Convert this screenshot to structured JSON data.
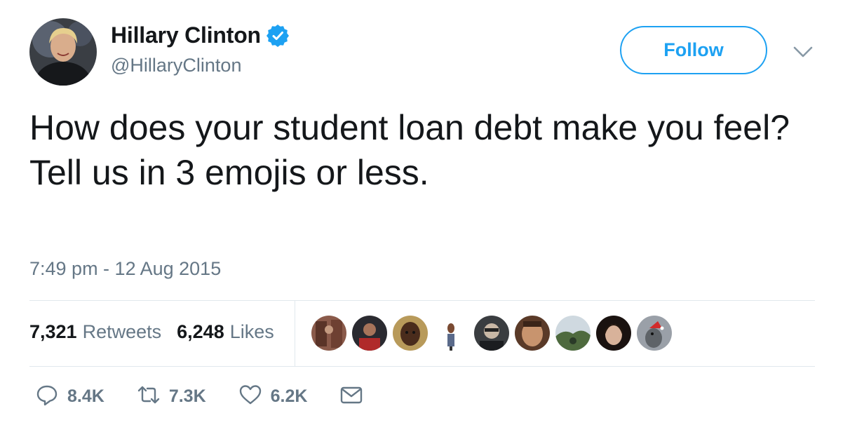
{
  "author": {
    "display_name": "Hillary Clinton",
    "handle": "@HillaryClinton",
    "verified": true
  },
  "follow_label": "Follow",
  "tweet": {
    "lines": [
      "How does your student loan debt make you feel?",
      "Tell us in 3 emojis or less."
    ],
    "timestamp": "7:49 pm - 12 Aug 2015"
  },
  "stats": {
    "retweets_count": "7,321",
    "retweets_label": "Retweets",
    "likes_count": "6,248",
    "likes_label": "Likes"
  },
  "likers": [
    {
      "icon": "liker-avatar",
      "bg": "#8a5a4a"
    },
    {
      "icon": "liker-avatar",
      "bg": "#7a2a2a"
    },
    {
      "icon": "liker-avatar",
      "bg": "#9a7a3a"
    },
    {
      "icon": "liker-avatar",
      "bg": "#e9eef2"
    },
    {
      "icon": "liker-avatar",
      "bg": "#3a3d40"
    },
    {
      "icon": "liker-avatar",
      "bg": "#6a4630"
    },
    {
      "icon": "liker-avatar",
      "bg": "#6f8a5c"
    },
    {
      "icon": "liker-avatar",
      "bg": "#2a1a16"
    },
    {
      "icon": "liker-avatar",
      "bg": "#8a8f96"
    }
  ],
  "actions": {
    "reply_count": "8.4K",
    "retweet_count": "7.3K",
    "like_count": "6.2K"
  },
  "colors": {
    "accent": "#1da1f2",
    "text": "#14171a",
    "muted": "#657786",
    "divider": "#e1e8ed"
  }
}
